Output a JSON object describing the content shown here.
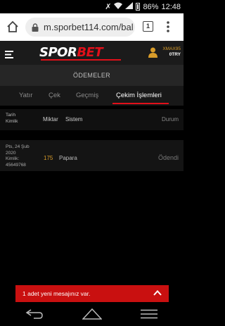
{
  "status_bar": {
    "battery": "86%",
    "time": "12:48"
  },
  "browser": {
    "url": "m.sporbet114.com/bal",
    "tab_count": "1"
  },
  "header": {
    "logo_part1": "SPOR",
    "logo_part2": "BET",
    "username": "XMAX95",
    "balance": "0TRY"
  },
  "page_title": "ÖDEMELER",
  "tabs": [
    {
      "label": "Yatır"
    },
    {
      "label": "Çek"
    },
    {
      "label": "Geçmiş"
    },
    {
      "label": "Çekim İşlemleri",
      "active": true
    }
  ],
  "table": {
    "headers": {
      "date_line1": "Tarih",
      "date_line2": "Kimlik",
      "amount": "Miktar",
      "system": "Sistem",
      "status": "Durum"
    },
    "rows": [
      {
        "date_line1": "Pts, 24 Şub",
        "date_line2": "2020",
        "id_label": "Kimlik:",
        "id": "45649768",
        "amount": "175",
        "system": "Papara",
        "status": "Ödendi"
      }
    ]
  },
  "toast": {
    "message": "1 adet yeni mesajınız var."
  },
  "colors": {
    "accent_red": "#e0101a",
    "gold": "#d89c2a",
    "toast_red": "#c91010"
  },
  "icons": [
    "home-icon",
    "lock-icon",
    "tab-switcher-icon",
    "more-vert-icon",
    "hamburger-menu-icon",
    "user-icon",
    "chevron-up-icon",
    "nav-back-icon",
    "nav-home-icon",
    "nav-recents-icon"
  ]
}
